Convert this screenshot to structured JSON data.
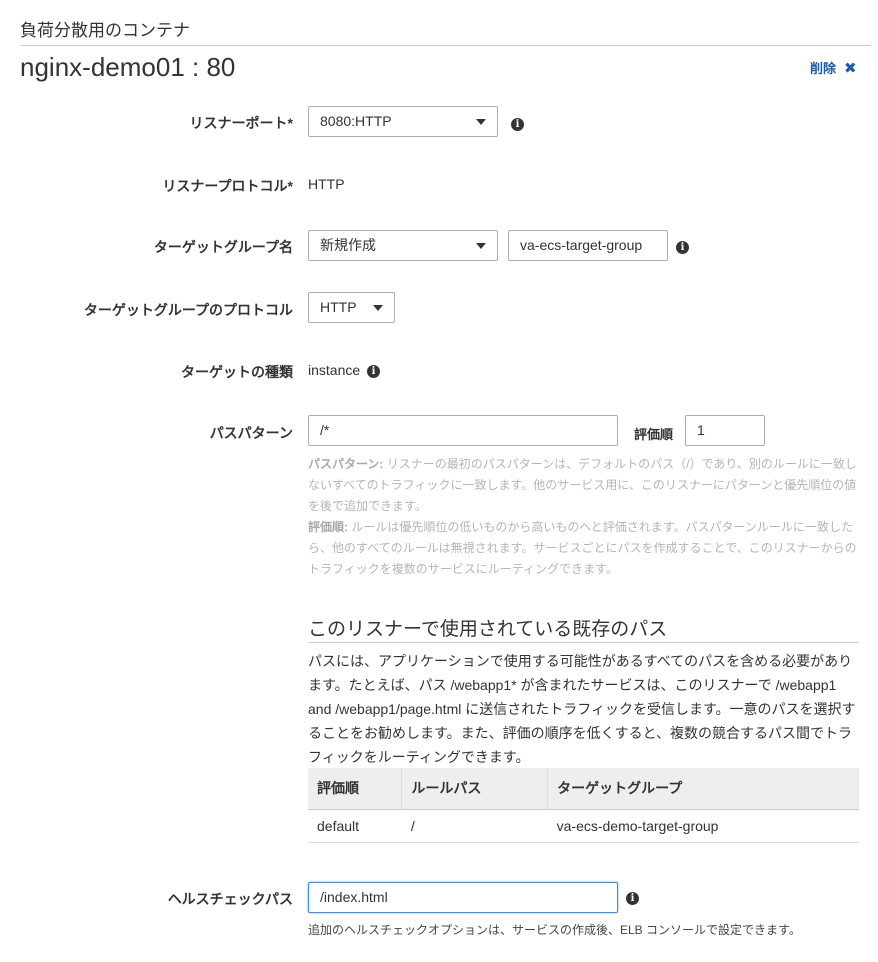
{
  "section_title": "負荷分散用のコンテナ",
  "container_title": "nginx-demo01 : 80",
  "delete_label": "削除",
  "delete_icon": "✖",
  "form": {
    "listener_port": {
      "label": "リスナーポート*",
      "value": "8080:HTTP"
    },
    "listener_protocol": {
      "label": "リスナープロトコル*",
      "value": "HTTP"
    },
    "target_group_name": {
      "label": "ターゲットグループ名",
      "select": "新規作成",
      "value": "va-ecs-target-group"
    },
    "target_group_protocol": {
      "label": "ターゲットグループのプロトコル",
      "value": "HTTP"
    },
    "target_type": {
      "label": "ターゲットの種類",
      "value": "instance"
    },
    "path_pattern": {
      "label": "パスパターン",
      "value": "/*",
      "order_label": "評価順",
      "order_value": "1"
    },
    "help": {
      "path_title": "パスパターン:",
      "path_text": " リスナーの最初のパスパターンは、デフォルトのパス（/）であり、別のルールに一致しないすべてのトラフィックに一致します。他のサービス用に、このリスナーにパターンと優先順位の値を後で追加できます。",
      "order_title": "評価順:",
      "order_text": " ルールは優先順位の低いものから高いものへと評価されます。パスパターンルールに一致したら、他のすべてのルールは無視されます。サービスごとにパスを作成することで、このリスナーからのトラフィックを複数のサービスにルーティングできます。"
    },
    "health_check": {
      "label": "ヘルスチェックパス",
      "value": "/index.html",
      "note": "追加のヘルスチェックオプションは、サービスの作成後、ELB コンソールで設定できます。"
    }
  },
  "existing_paths": {
    "title": "このリスナーで使用されている既存のパス",
    "description": "パスには、アプリケーションで使用する可能性があるすべてのパスを含める必要があります。たとえば、パス /webapp1* が含まれたサービスは、このリスナーで /webapp1 and /webapp1/page.html に送信されたトラフィックを受信します。一意のパスを選択することをお勧めします。また、評価の順序を低くすると、複数の競合するパス間でトラフィックをルーティングできます。",
    "columns": [
      "評価順",
      "ルールパス",
      "ターゲットグループ"
    ],
    "rows": [
      [
        "default",
        "/",
        "va-ecs-demo-target-group"
      ]
    ]
  }
}
